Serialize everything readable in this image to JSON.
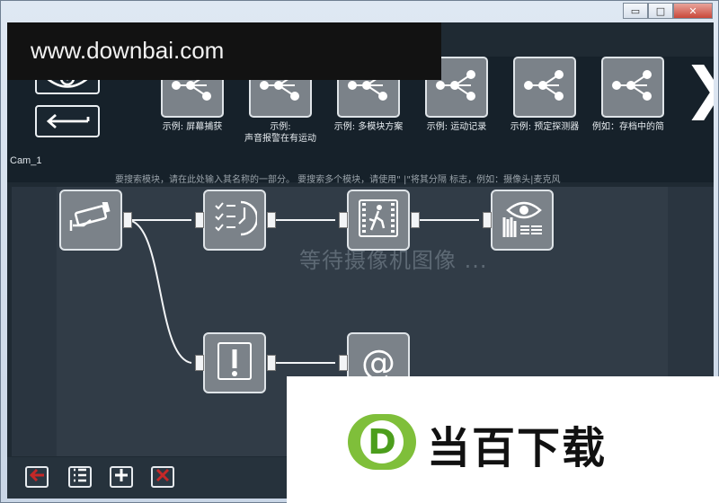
{
  "watermark_top": "www.downbai.com",
  "window_controls": {
    "minimize": "▭",
    "maximize": "□",
    "close": "✕"
  },
  "sidebar": {
    "camera_label": "Cam_1"
  },
  "examples": [
    {
      "label": "示例: 屏幕捕获"
    },
    {
      "label": "示例:\n声音报警在有运动"
    },
    {
      "label": "示例: 多模块方案"
    },
    {
      "label": "示例: 运动记录"
    },
    {
      "label": "示例: 预定探测器"
    },
    {
      "label": "例如：存档中的简"
    }
  ],
  "hint": "要搜索模块，请在此处输入其名称的一部分。 要搜索多个模块，请使用\" |\"将其分隔 标志，例如：摄像头|麦克风",
  "canvas": {
    "waiting_text": "等待摄像机图像 ..."
  },
  "nodes": [
    {
      "icon": "camera-icon"
    },
    {
      "icon": "schedule-icon"
    },
    {
      "icon": "motion-detector-icon"
    },
    {
      "icon": "archive-viewer-icon"
    },
    {
      "icon": "alert-icon"
    },
    {
      "icon": "email-icon"
    }
  ],
  "watermark_bottom": {
    "logo": "D",
    "text": "当百下载"
  },
  "colors": {
    "accent_red": "#c62828",
    "node_fill": "#7b8289",
    "wm_green": "#7fbf3a"
  }
}
